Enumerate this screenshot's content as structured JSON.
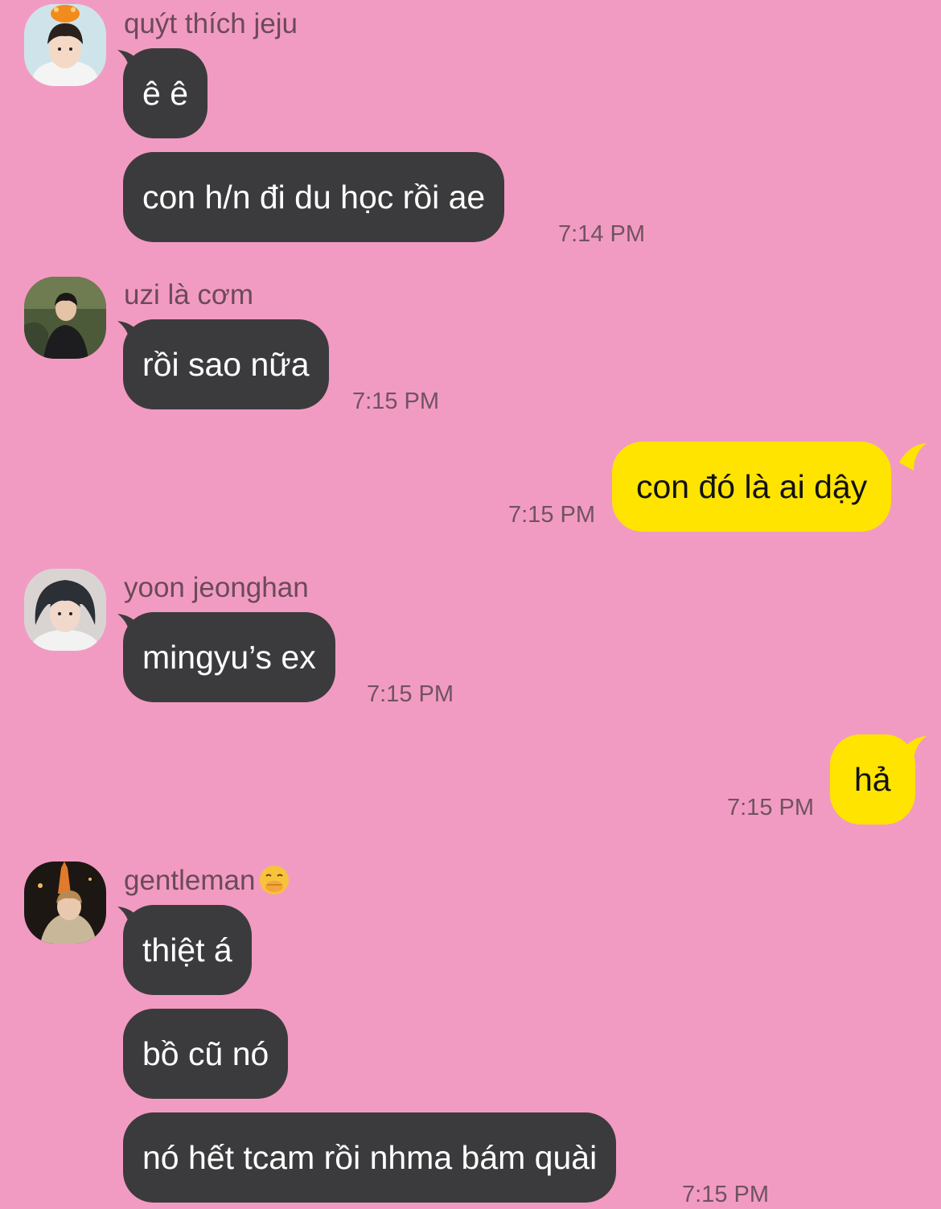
{
  "colors": {
    "background": "#f29bc2",
    "incoming_bubble": "#3b3b3d",
    "outgoing_bubble": "#ffe400"
  },
  "messages": [
    {
      "sender": "quýt thích jeju",
      "avatar": "avatar-orange-headpiece",
      "bubbles": [
        "ê ê",
        "con h/n đi du học rồi ae"
      ],
      "time": "7:14 PM"
    },
    {
      "sender": "uzi là cơm",
      "avatar": "avatar-outdoor-photo",
      "bubbles": [
        "rồi sao nữa"
      ],
      "time": "7:15 PM"
    },
    {
      "outgoing": true,
      "bubbles": [
        "con đó là ai dậy"
      ],
      "time": "7:15 PM"
    },
    {
      "sender": "yoon jeonghan",
      "avatar": "avatar-dark-hair-portrait",
      "bubbles": [
        "mingyu’s ex"
      ],
      "time": "7:15 PM"
    },
    {
      "outgoing": true,
      "bubbles": [
        "hả"
      ],
      "time": "7:15 PM"
    },
    {
      "sender": "gentleman",
      "sender_emoji": "hand-over-mouth-emoji",
      "avatar": "avatar-night-tower",
      "bubbles": [
        "thiệt á",
        "bồ cũ nó",
        "nó hết tcam rồi nhma bám quài"
      ],
      "time": "7:15 PM"
    }
  ]
}
